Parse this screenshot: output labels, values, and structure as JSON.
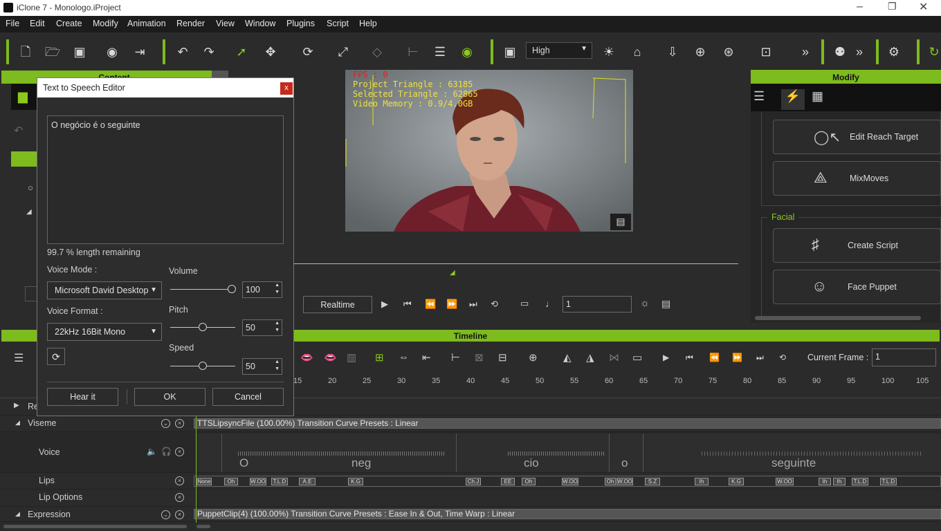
{
  "window": {
    "title": "iClone 7 - Monologo.iProject"
  },
  "menu": [
    "File",
    "Edit",
    "Create",
    "Modify",
    "Animation",
    "Render",
    "View",
    "Window",
    "Plugins",
    "Script",
    "Help"
  ],
  "toolbar": {
    "quality": "High"
  },
  "viewport": {
    "fps": "FPS : 0",
    "project_triangle": "Project Triangle : 63185",
    "selected_triangle": "Selected Triangle : 62865",
    "video_memory": "Video Memory : 0.9/4.0GB"
  },
  "content_panel": {
    "title": "Content"
  },
  "modify_panel": {
    "title": "Modify",
    "buttons": [
      "Edit Reach Target",
      "MixMoves"
    ],
    "facial_label": "Facial",
    "facial_buttons": [
      "Create Script",
      "Face Puppet"
    ]
  },
  "tts": {
    "title": "Text to Speech Editor",
    "close": "x",
    "text": "O negócio é o seguinte",
    "remaining": "99.7  % length remaining",
    "voice_mode_label": "Voice Mode :",
    "voice_mode": "Microsoft David Desktop",
    "voice_format_label": "Voice Format :",
    "voice_format": "22kHz 16Bit Mono",
    "volume_label": "Volume",
    "volume": "100",
    "pitch_label": "Pitch",
    "pitch": "50",
    "speed_label": "Speed",
    "speed": "50",
    "hear": "Hear it",
    "ok": "OK",
    "cancel": "Cancel"
  },
  "playback": {
    "realtime": "Realtime",
    "frame": "1"
  },
  "timeline": {
    "title": "Timeline",
    "current_frame_label": "Current Frame :",
    "current_frame": "1",
    "ticks": [
      "15",
      "20",
      "25",
      "30",
      "35",
      "40",
      "45",
      "50",
      "55",
      "60",
      "65",
      "70",
      "75",
      "80",
      "85",
      "90",
      "95",
      "100",
      "105"
    ],
    "tracks": {
      "re": "Re",
      "viseme": "Viseme",
      "voice": "Voice",
      "lips": "Lips",
      "lip_options": "Lip Options",
      "expression": "Expression"
    },
    "viseme_clip": "TTSLipsyncFile (100.00%) Transition Curve Presets : Linear",
    "expression_clip": "PuppetClip(4) (100.00%) Transition Curve Presets : Ease In & Out, Time Warp : Linear",
    "words": [
      "O",
      "neg",
      "cio",
      "o",
      "seguinte"
    ],
    "lips": [
      "None",
      "Oh",
      "W.OO",
      "T.L.D",
      "A.E",
      "K.G",
      "Ch.J",
      "EE",
      "Oh",
      "W.OO",
      "Oh",
      "W.OO",
      "S.Z",
      "Ih",
      "K.G",
      "W.OO",
      "Ih",
      "Ih",
      "T.L.D",
      "T.L.D"
    ]
  }
}
